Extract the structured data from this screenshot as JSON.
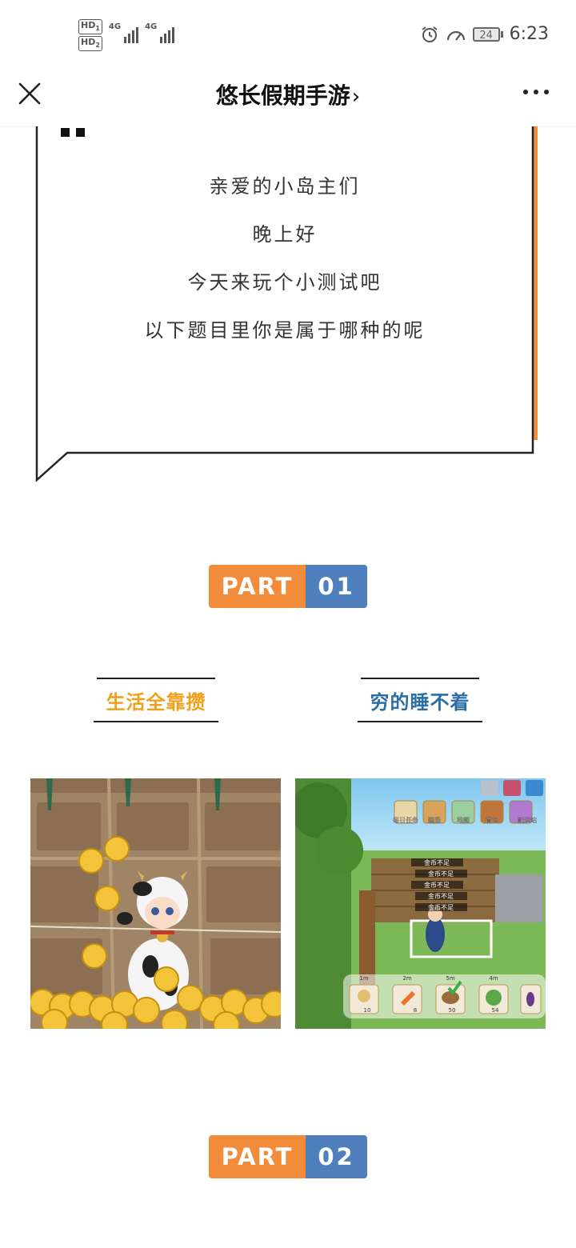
{
  "status_bar": {
    "hd1": "HD",
    "hd1_sub": "1",
    "hd2": "HD",
    "hd2_sub": "2",
    "net1": "4G",
    "net2": "4G",
    "battery": "24",
    "time": "6:23"
  },
  "nav": {
    "title": "悠长假期手游",
    "chevron": "›"
  },
  "bubble": {
    "lines": [
      "亲爱的小岛主们",
      "晚上好",
      "今天来玩个小测试吧",
      "以下题目里你是属于哪种的呢"
    ]
  },
  "part1": {
    "label": "PART",
    "number": "01"
  },
  "part2": {
    "label": "PART",
    "number": "02"
  },
  "options": [
    {
      "caption": "生活全靠攒",
      "color": "#f2a01a"
    },
    {
      "caption": "穷的睡不着",
      "color": "#2c6ea3"
    }
  ],
  "game_ui": {
    "menu": [
      "每日任务",
      "建造",
      "地图",
      "背包",
      "配送站"
    ],
    "warning": "金币不足",
    "slot_times": [
      "1m",
      "2m",
      "5m",
      "4m"
    ],
    "slot_prices": [
      "10",
      "8",
      "50",
      "54"
    ]
  },
  "colors": {
    "orange": "#f28c3a",
    "blue": "#4f7fbd",
    "gold_text": "#f2a01a",
    "teal_text": "#2c6ea3"
  }
}
